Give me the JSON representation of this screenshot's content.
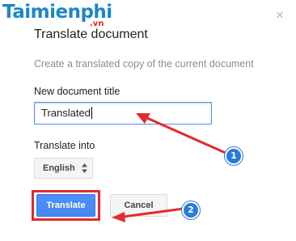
{
  "watermark": {
    "brand": "Taimienphi",
    "suffix": ".vn"
  },
  "dialog": {
    "title": "Translate document",
    "description": "Create a translated copy of the current document",
    "close_symbol": "×",
    "fields": {
      "title_label": "New document title",
      "title_value": "Translated",
      "lang_label": "Translate into",
      "lang_value": "English"
    },
    "buttons": {
      "translate": "Translate",
      "cancel": "Cancel"
    }
  },
  "annotations": {
    "badge_1": "1",
    "badge_2": "2",
    "arrow_color": "#e22b2b",
    "badge_color": "#2a7bd6"
  },
  "colors": {
    "primary_button": "#4d90fe",
    "input_focus_border": "#4d90fe",
    "highlight_border": "#e22b2b",
    "watermark_blue": "#1e86c7",
    "watermark_red": "#e0262b"
  },
  "icons": {
    "close": "close-icon",
    "select": "updown-arrow-icon"
  }
}
